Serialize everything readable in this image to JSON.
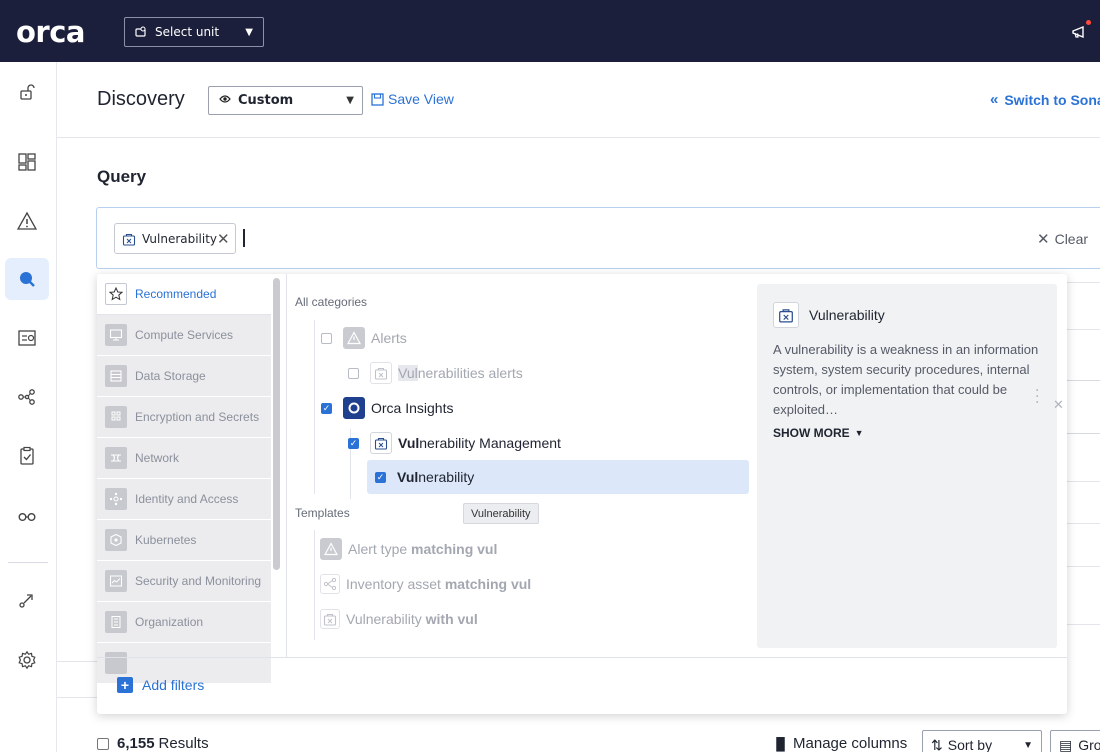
{
  "topbar": {
    "logo_text": "orca",
    "unit_select": {
      "label": "Select unit"
    }
  },
  "header": {
    "title": "Discovery",
    "view_select": "Custom",
    "save_view": "Save View",
    "switch_to": "Switch to Sonar"
  },
  "query": {
    "title": "Query",
    "chip": "Vulnerability",
    "clear": "Clear"
  },
  "categories": [
    {
      "label": "Recommended",
      "icon": "star-icon",
      "active": true
    },
    {
      "label": "Compute Services",
      "icon": "monitor-icon"
    },
    {
      "label": "Data Storage",
      "icon": "database-icon"
    },
    {
      "label": "Encryption and Secrets",
      "icon": "key-grid-icon"
    },
    {
      "label": "Network",
      "icon": "network-icon"
    },
    {
      "label": "Identity and Access",
      "icon": "identity-icon"
    },
    {
      "label": "Kubernetes",
      "icon": "kubernetes-icon"
    },
    {
      "label": "Security and Monitoring",
      "icon": "shield-chart-icon"
    },
    {
      "label": "Organization",
      "icon": "building-icon"
    }
  ],
  "tree": {
    "all_categories_label": "All categories",
    "templates_label": "Templates",
    "rows": {
      "alerts": {
        "label": "Alerts"
      },
      "vuln_alerts": {
        "match": "Vul",
        "rest": "nerabilities alerts"
      },
      "orca_insights": {
        "label": "Orca Insights"
      },
      "vuln_mgmt": {
        "match": "Vul",
        "rest": "nerability Management"
      },
      "vulnerability": {
        "match": "Vul",
        "rest": "nerability"
      }
    },
    "templates": [
      {
        "prefix": "Alert type ",
        "match": "matching vul",
        "icon": "alert-triangle-icon"
      },
      {
        "prefix": "Inventory asset ",
        "match": "matching vul",
        "icon": "inventory-graph-icon"
      },
      {
        "prefix": "Vulnerability ",
        "match": "with vul",
        "icon": "vulnerability-icon"
      }
    ],
    "tooltip": "Vulnerability"
  },
  "detail": {
    "title": "Vulnerability",
    "description": "A vulnerability is a weakness in an information system, system security procedures, internal controls, or implementation that could be exploited…",
    "show_more": "SHOW MORE"
  },
  "add_filters": "Add filters",
  "results": {
    "count": "6,155",
    "label": "Results",
    "manage_columns": "Manage columns",
    "sort_by": "Sort by",
    "group": "Group"
  },
  "colors": {
    "topbar_bg": "#1b1f3b",
    "accent": "#2a72d6",
    "selected_row": "#dce8fa"
  }
}
